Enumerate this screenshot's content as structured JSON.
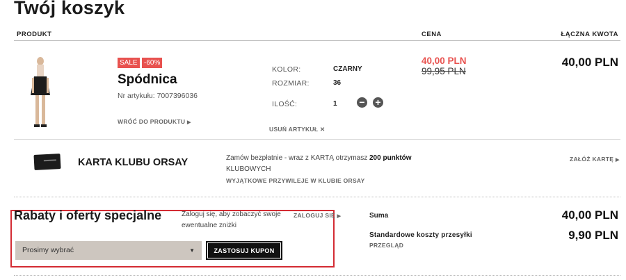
{
  "page": {
    "title": "Twój koszyk"
  },
  "columns": {
    "product": "PRODUKT",
    "price": "CENA",
    "total": "ŁĄCZNA KWOTA"
  },
  "item": {
    "sale_badge": "SALE",
    "discount_badge": "-60%",
    "name": "Spódnica",
    "sku": "Nr artykułu: 7007396036",
    "back_link": "WRÓĆ DO PRODUKTU",
    "color_label": "KOLOR:",
    "color_value": "CZARNY",
    "size_label": "ROZMIAR:",
    "size_value": "36",
    "qty_label": "ILOŚĆ:",
    "qty_value": "1",
    "remove_link": "USUŃ ARTYKUŁ",
    "price_new": "40,00 PLN",
    "price_old": "99,95 PLN",
    "line_total": "40,00 PLN"
  },
  "club": {
    "name": "KARTA KLUBU ORSAY",
    "text_before": "Zamów bezpłatnie - wraz z KARTĄ otrzymasz ",
    "text_bold": "200 punktów",
    "text_after": "KLUBOWYCH",
    "privileges_link": "WYJĄTKOWE PRZYWILEJE W KLUBIE ORSAY",
    "create_link": "ZAŁÓŻ KARTĘ"
  },
  "discounts": {
    "title": "Rabaty i oferty specjalne",
    "note": "Zaloguj się, aby zobaczyć swoje ewentualne zniżki",
    "login_link": "ZALOGUJ SIĘ",
    "select_placeholder": "Prosimy wybrać",
    "apply_button": "ZASTOSUJ KUPON"
  },
  "summary": {
    "sum_label": "Suma",
    "sum_value": "40,00 PLN",
    "shipping_label": "Standardowe koszty przesyłki",
    "shipping_value": "9,90 PLN",
    "details_link": "PRZEGLĄD"
  },
  "colors": {
    "accent_red": "#e8524f",
    "highlight_box": "#d32b33",
    "select_bg": "#cdc6bf"
  }
}
